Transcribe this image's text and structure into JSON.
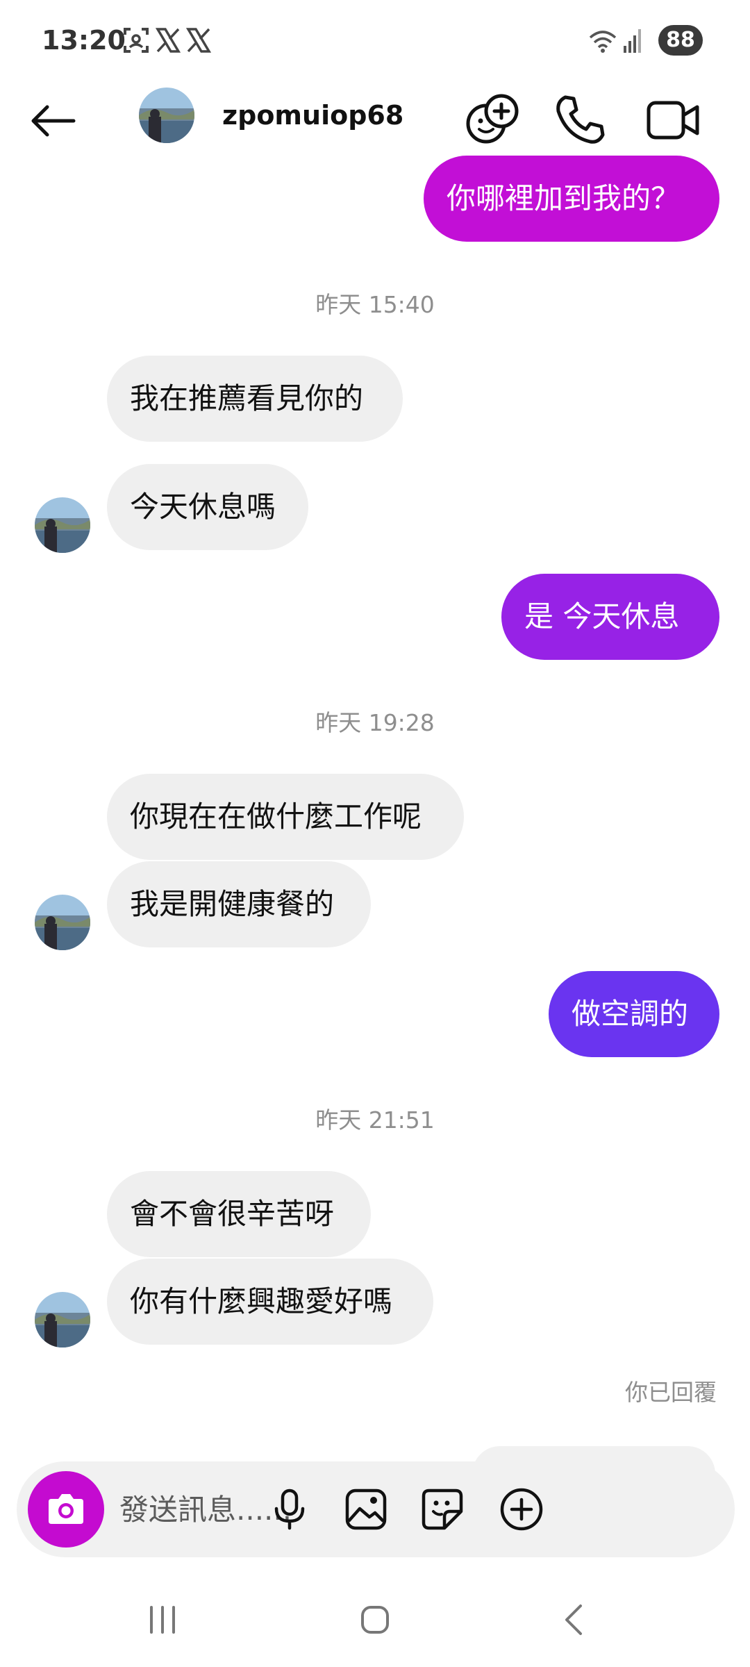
{
  "status_bar": {
    "time": "13:20",
    "battery": "88"
  },
  "header": {
    "username": "zpomuiop68"
  },
  "messages": {
    "m1": "你哪裡加到我的？",
    "ts1": "昨天 15:40",
    "m2": "我在推薦看見你的",
    "m3": "今天休息嗎",
    "m4": "是  今天休息",
    "ts2": "昨天 19:28",
    "m5": "你現在在做什麼工作呢",
    "m6": "我是開健康餐的",
    "m7": "做空調的",
    "ts3": "昨天 21:51",
    "m8": "會不會很辛苦呀",
    "m9": "你有什麼興趣愛好嗎",
    "replied": "你已回覆"
  },
  "composer": {
    "placeholder": "發送訊息......"
  },
  "icons": {
    "back": "arrow-left-icon",
    "effects": "face-plus-icon",
    "call": "phone-icon",
    "video": "video-camera-icon",
    "camera": "camera-icon",
    "mic": "microphone-icon",
    "gallery": "image-icon",
    "sticker": "sticker-icon",
    "more": "plus-circle-icon"
  },
  "colors": {
    "bubble_out_1": "#c20fd6",
    "bubble_out_2": "#9722e6",
    "bubble_out_3": "#6a34f0",
    "bubble_in": "#efefef"
  }
}
